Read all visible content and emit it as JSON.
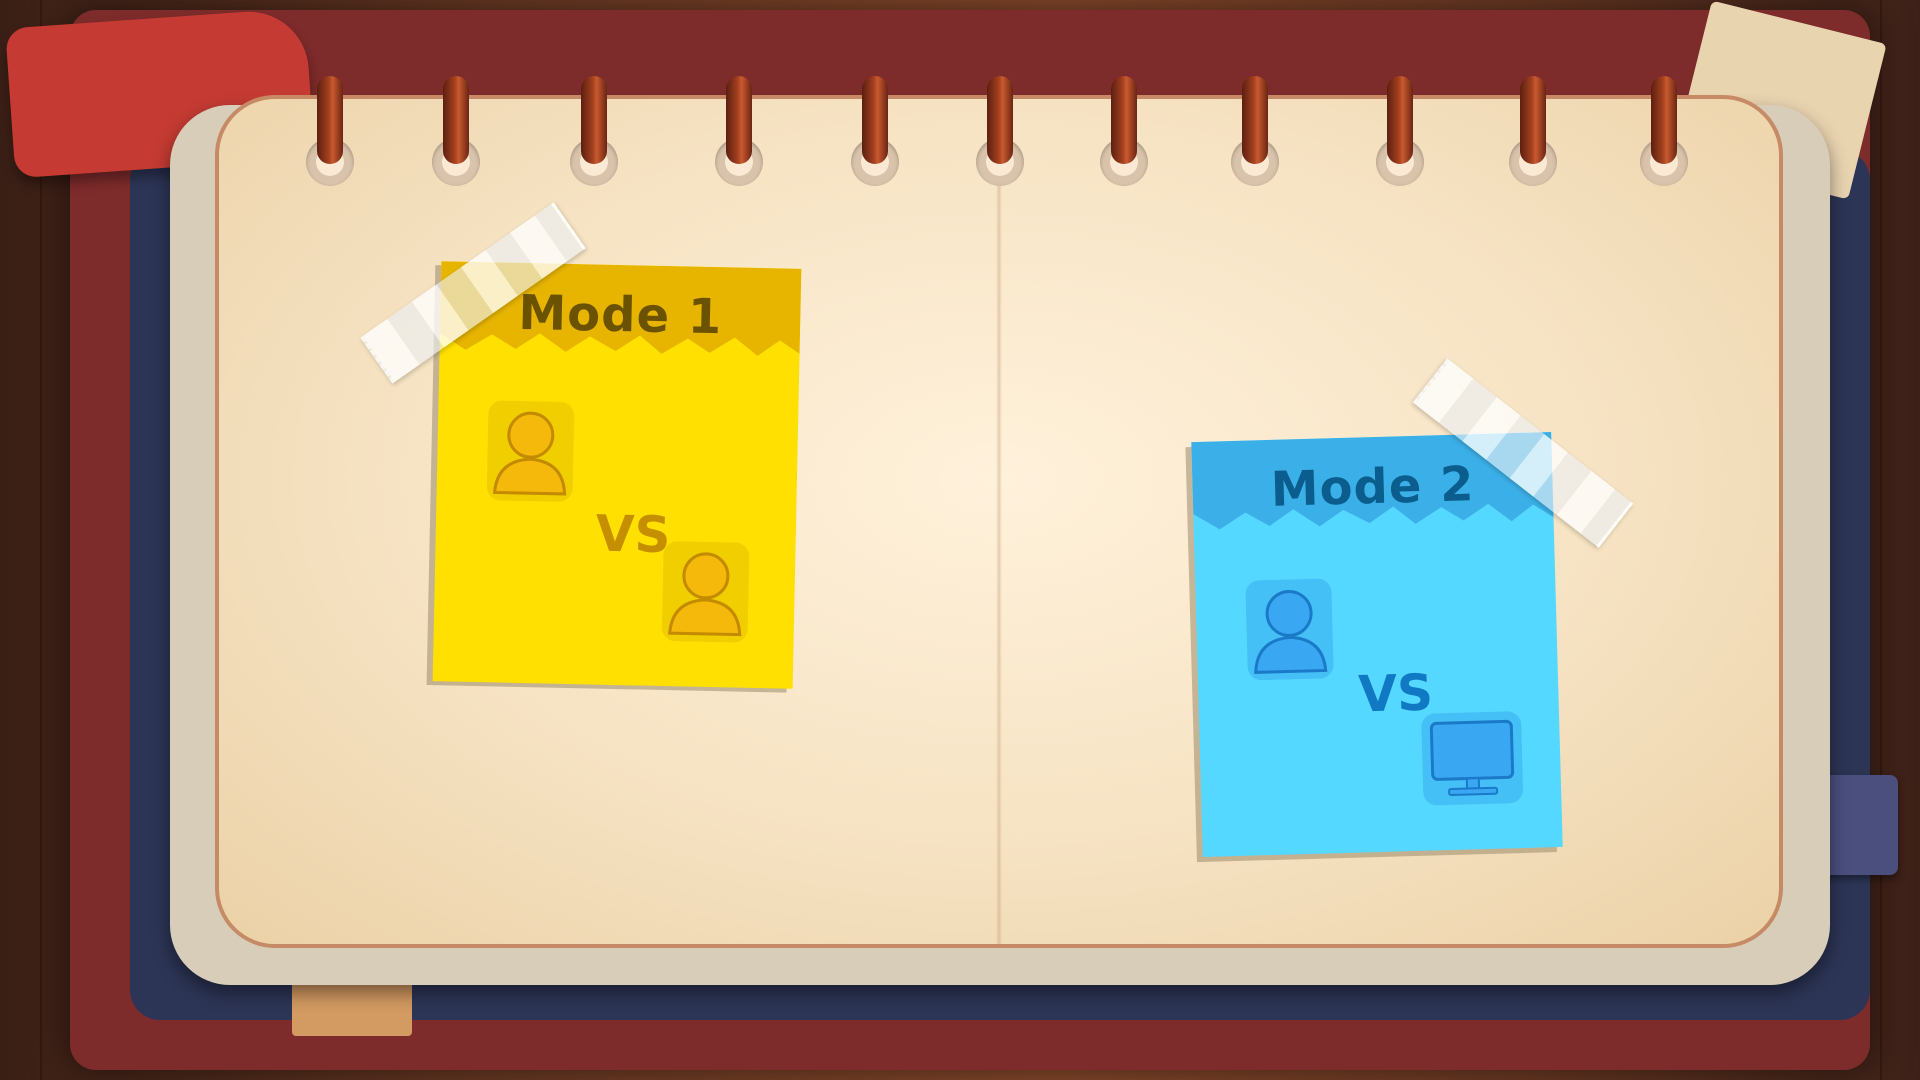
{
  "mode_cards": [
    {
      "title": "Mode 1",
      "versus": "VS",
      "player_a_icon": "person-icon",
      "player_b_icon": "person-icon",
      "head_color": "#e7b400",
      "body_color": "#ffe001",
      "text_color": "#6b5200",
      "icon_color": "#f4b90b"
    },
    {
      "title": "Mode 2",
      "versus": "VS",
      "player_a_icon": "person-icon",
      "player_b_icon": "computer-monitor-icon",
      "head_color": "#3bb0e8",
      "body_color": "#55d8ff",
      "text_color": "#0a5d8c",
      "icon_color": "#3aa7f2"
    }
  ],
  "colors": {
    "cover": "#7e2b2b",
    "page": "#fff1db",
    "page_border": "#c68b66",
    "ring": "#a34020"
  }
}
